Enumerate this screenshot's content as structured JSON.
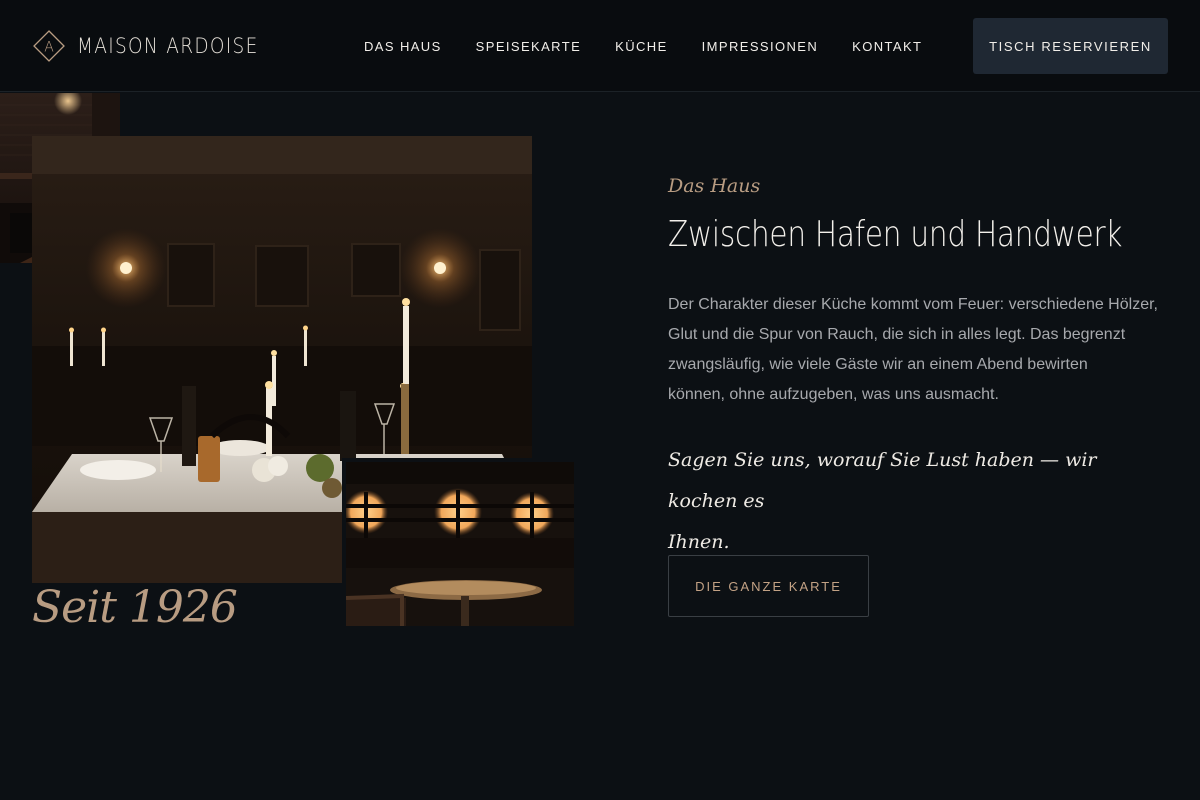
{
  "header": {
    "brand": {
      "name": "MAISON ARDOISE",
      "monogram": "A",
      "icon": "diamond-monogram-icon"
    },
    "nav": [
      {
        "label": "DAS HAUS"
      },
      {
        "label": "SPEISEKARTE"
      },
      {
        "label": "KÜCHE"
      },
      {
        "label": "IMPRESSIONEN"
      },
      {
        "label": "KONTAKT"
      }
    ],
    "cta_label": "TISCH RESERVIEREN"
  },
  "gallery": {
    "caption": "Seit 1926"
  },
  "about": {
    "eyebrow": "Das Haus",
    "title": "Zwischen Hafen und Handwerk",
    "body_lines": [
      "Der Charakter dieser Küche kommt vom Feuer: verschiedene Hölzer,",
      "Glut und die Spur von Rauch, die sich in alles legt. Das begrenzt",
      "zwangsläufig, wie viele Gäste wir an einem Abend bewirten",
      "können, ohne aufzugeben, was uns ausmacht."
    ],
    "quote_lines": [
      "Sagen Sie uns, worauf Sie Lust haben — wir kochen es",
      "Ihnen."
    ],
    "button_label": "DIE GANZE KARTE"
  },
  "colors": {
    "background": "#0c1014",
    "header_bg": "#090c0f",
    "accent": "#b89c82",
    "button_bg": "#1f2833",
    "text_muted": "#a7a9ad"
  }
}
